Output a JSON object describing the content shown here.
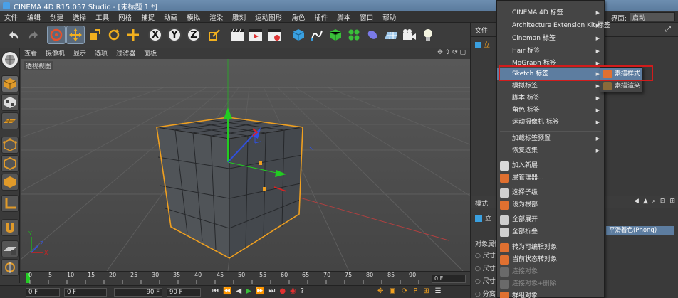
{
  "window": {
    "title": "CINEMA 4D R15.057 Studio - [未标题 1 *]"
  },
  "menubar": {
    "items": [
      "文件",
      "编辑",
      "创建",
      "选择",
      "工具",
      "网格",
      "捕捉",
      "动画",
      "模拟",
      "渲染",
      "雕刻",
      "运动图形",
      "角色",
      "插件",
      "脚本",
      "窗口",
      "帮助"
    ],
    "layout_label": "界面:",
    "layout_value": "启动"
  },
  "viewport": {
    "menu": [
      "查看",
      "摄像机",
      "显示",
      "选项",
      "过滤器",
      "面板"
    ],
    "label": "透视视图"
  },
  "timeline": {
    "ticks": [
      "0",
      "5",
      "10",
      "15",
      "20",
      "25",
      "30",
      "35",
      "40",
      "45",
      "50",
      "55",
      "60",
      "65",
      "70",
      "75",
      "80",
      "85",
      "90"
    ],
    "current_frame": "0 F",
    "start_field": "0 F",
    "min_field": "0 F",
    "max_field": "90 F",
    "end_field": "90 F"
  },
  "right_panel": {
    "top_tab": "文件",
    "object_item": "立",
    "mode_tab": "模式",
    "object_label": "立",
    "attributes_label": "对象属性",
    "size_rows": [
      "尺寸 .",
      "尺寸 .",
      "尺寸 ."
    ],
    "phong_button": "平滑着色(Phong)",
    "bottom_row": "分离表"
  },
  "context_menu": {
    "items": [
      {
        "label": "CINEMA 4D 标签",
        "submenu": true
      },
      {
        "label": "Architecture Extension Kit 标签",
        "submenu": true
      },
      {
        "label": "Cineman 标签",
        "submenu": true
      },
      {
        "label": "Hair 标签",
        "submenu": true
      },
      {
        "label": "MoGraph 标签",
        "submenu": true
      },
      {
        "label": "Sketch 标签",
        "submenu": true,
        "highlighted": true
      },
      {
        "label": "模拟标签",
        "submenu": true
      },
      {
        "label": "脚本 标签",
        "submenu": true
      },
      {
        "label": "角色 标签",
        "submenu": true
      },
      {
        "label": "运动摄像机 标签",
        "submenu": true
      },
      {
        "label": "加载标签预置",
        "submenu": true
      },
      {
        "label": "恢复选集",
        "submenu": true
      },
      {
        "label": "加入新层"
      },
      {
        "label": "层管理器..."
      },
      {
        "label": "选择子级"
      },
      {
        "label": "设为根部"
      },
      {
        "label": "全部展开"
      },
      {
        "label": "全部折叠"
      },
      {
        "label": "转为可编辑对象"
      },
      {
        "label": "当前状态转对象"
      },
      {
        "label": "连接对象"
      },
      {
        "label": "连接对象+删除"
      },
      {
        "label": "群组对象"
      }
    ],
    "submenu_items": [
      "素描样式",
      "素描渲染"
    ]
  },
  "colors": {
    "highlight": "#5d7da0",
    "selection_orange": "#f0a020",
    "annotation_red": "#d21c1c",
    "axis_y_green": "#22cc22"
  },
  "icons": {
    "undo": "undo-icon",
    "redo": "redo-icon",
    "move": "move-icon",
    "scale": "scale-icon",
    "rotate": "rotate-icon",
    "cube": "cube-icon",
    "camera": "camera-icon",
    "light": "light-icon",
    "magnet": "magnet-icon"
  }
}
